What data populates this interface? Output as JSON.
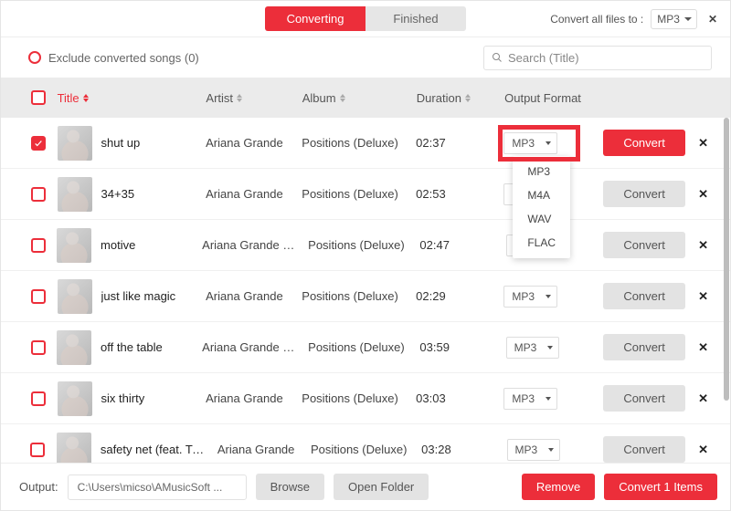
{
  "topbar": {
    "tabs": [
      {
        "label": "Converting",
        "active": true
      },
      {
        "label": "Finished",
        "active": false
      }
    ],
    "convert_all_label": "Convert all files to :",
    "convert_all_value": "MP3"
  },
  "subbar": {
    "exclude_label": "Exclude converted songs (0)",
    "search_placeholder": "Search  (Title)"
  },
  "table": {
    "columns": {
      "title": "Title",
      "artist": "Artist",
      "album": "Album",
      "duration": "Duration",
      "format": "Output Format"
    },
    "rows": [
      {
        "checked": true,
        "title": "shut up",
        "artist": "Ariana Grande",
        "album": "Positions (Deluxe)",
        "duration": "02:37",
        "format": "MP3",
        "convert_label": "Convert",
        "primary": true
      },
      {
        "checked": false,
        "title": "34+35",
        "artist": "Ariana Grande",
        "album": "Positions (Deluxe)",
        "duration": "02:53",
        "format": "MP3",
        "convert_label": "Convert",
        "primary": false
      },
      {
        "checked": false,
        "title": "motive",
        "artist": "Ariana Grande & ...",
        "album": "Positions (Deluxe)",
        "duration": "02:47",
        "format": "MP3",
        "convert_label": "Convert",
        "primary": false
      },
      {
        "checked": false,
        "title": "just like magic",
        "artist": "Ariana Grande",
        "album": "Positions (Deluxe)",
        "duration": "02:29",
        "format": "MP3",
        "convert_label": "Convert",
        "primary": false
      },
      {
        "checked": false,
        "title": "off the table",
        "artist": "Ariana Grande & ...",
        "album": "Positions (Deluxe)",
        "duration": "03:59",
        "format": "MP3",
        "convert_label": "Convert",
        "primary": false
      },
      {
        "checked": false,
        "title": "six thirty",
        "artist": "Ariana Grande",
        "album": "Positions (Deluxe)",
        "duration": "03:03",
        "format": "MP3",
        "convert_label": "Convert",
        "primary": false
      },
      {
        "checked": false,
        "title": "safety net (feat. Ty ...",
        "artist": "Ariana Grande",
        "album": "Positions (Deluxe)",
        "duration": "03:28",
        "format": "MP3",
        "convert_label": "Convert",
        "primary": false
      }
    ],
    "dropdown": {
      "open_row_index": 0,
      "options": [
        "MP3",
        "M4A",
        "WAV",
        "FLAC"
      ]
    }
  },
  "bottombar": {
    "output_label": "Output:",
    "output_path": "C:\\Users\\micso\\AMusicSoft ...",
    "browse": "Browse",
    "open_folder": "Open Folder",
    "remove": "Remove",
    "convert_n": "Convert 1 Items"
  },
  "colors": {
    "accent": "#ec2e3a",
    "muted": "#e3e3e3"
  }
}
